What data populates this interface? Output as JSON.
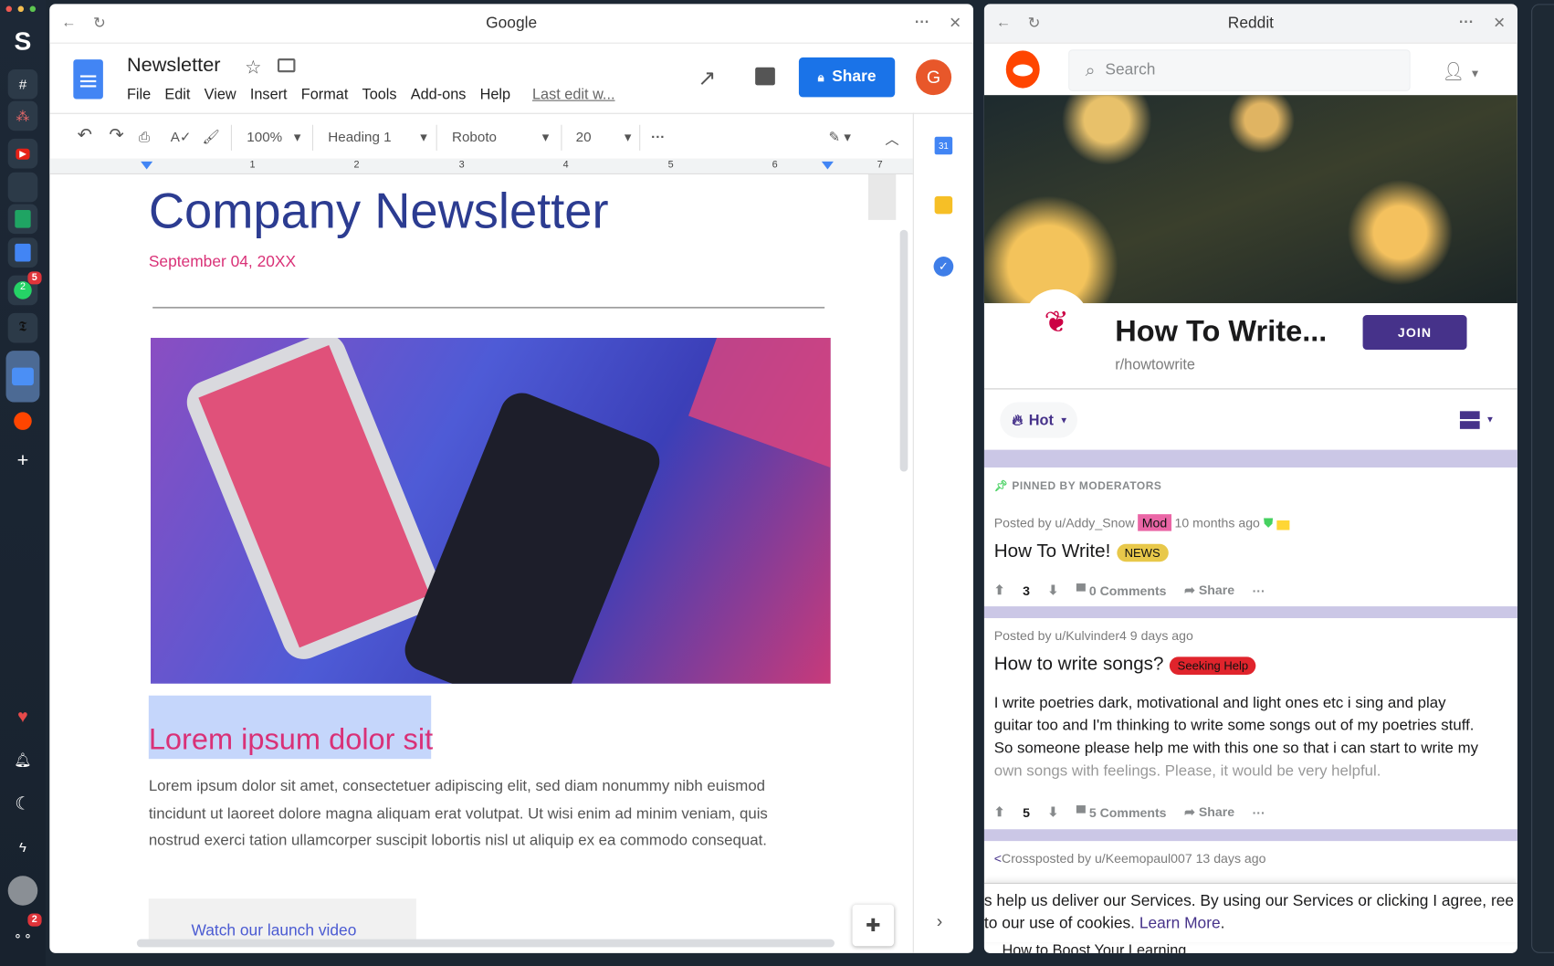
{
  "dock": {
    "whatsapp_badge": "5",
    "whatsapp_count": "2",
    "apps_badge": "2"
  },
  "docs": {
    "window_title": "Google",
    "doc_title": "Newsletter",
    "menu": [
      "File",
      "Edit",
      "View",
      "Insert",
      "Format",
      "Tools",
      "Add-ons",
      "Help"
    ],
    "last_edit": "Last edit w...",
    "share_label": "Share",
    "avatar_letter": "G",
    "toolbar": {
      "zoom": "100%",
      "style": "Heading 1",
      "font": "Roboto",
      "size": "20"
    },
    "ruler": [
      "1",
      "2",
      "3",
      "4",
      "5",
      "6",
      "7"
    ],
    "calendar_label": "31",
    "heading": "Company Newsletter",
    "date": "September 04, 20XX",
    "subheading": "Lorem ipsum dolor sit",
    "body": "Lorem ipsum dolor sit amet, consectetuer adipiscing elit, sed diam nonummy nibh euismod tincidunt ut laoreet dolore magna aliquam erat volutpat. Ut wisi enim ad minim veniam, quis nostrud exerci tation ullamcorper suscipit lobortis nisl ut aliquip ex ea commodo consequat.",
    "video_link": "Watch our launch video"
  },
  "reddit": {
    "window_title": "Reddit",
    "search_placeholder": "Search",
    "community_name": "How To Write...",
    "community_slug": "r/howtowrite",
    "join_label": "JOIN",
    "sort_label": "Hot",
    "pinned_label": "PINNED BY MODERATORS",
    "posts": [
      {
        "meta": "Posted by u/Addy_Snow",
        "mod": "Mod",
        "time": "10 months ago",
        "title": "How To Write!",
        "flair": "NEWS",
        "votes": "3",
        "comments": "0 Comments",
        "share": "Share"
      },
      {
        "meta": "Posted by u/Kulvinder4 9 days ago",
        "title": "How to write songs?",
        "flair": "Seeking Help",
        "body": "I write poetries dark, motivational and light ones etc i sing and play guitar too and I'm thinking to write some songs out of my poetries stuff. So someone please help me with this one so that i can start to write my own songs with feelings. Please, it would be very helpful.",
        "votes": "5",
        "comments": "5 Comments",
        "share": "Share"
      },
      {
        "meta": "Crossposted by u/Keemopaul007 13 days ago",
        "title": "How to Boost Your Learning"
      }
    ],
    "cookie_text": "s help us deliver our Services. By using our Services or clicking I agree, ree to our use of cookies.",
    "cookie_link": "Learn More"
  },
  "colors": {
    "docs_blue": "#1a73e8",
    "reddit_orange": "#ff4500",
    "reddit_purple": "#46328a",
    "heading": "#2c3c91",
    "pink": "#d93177"
  }
}
